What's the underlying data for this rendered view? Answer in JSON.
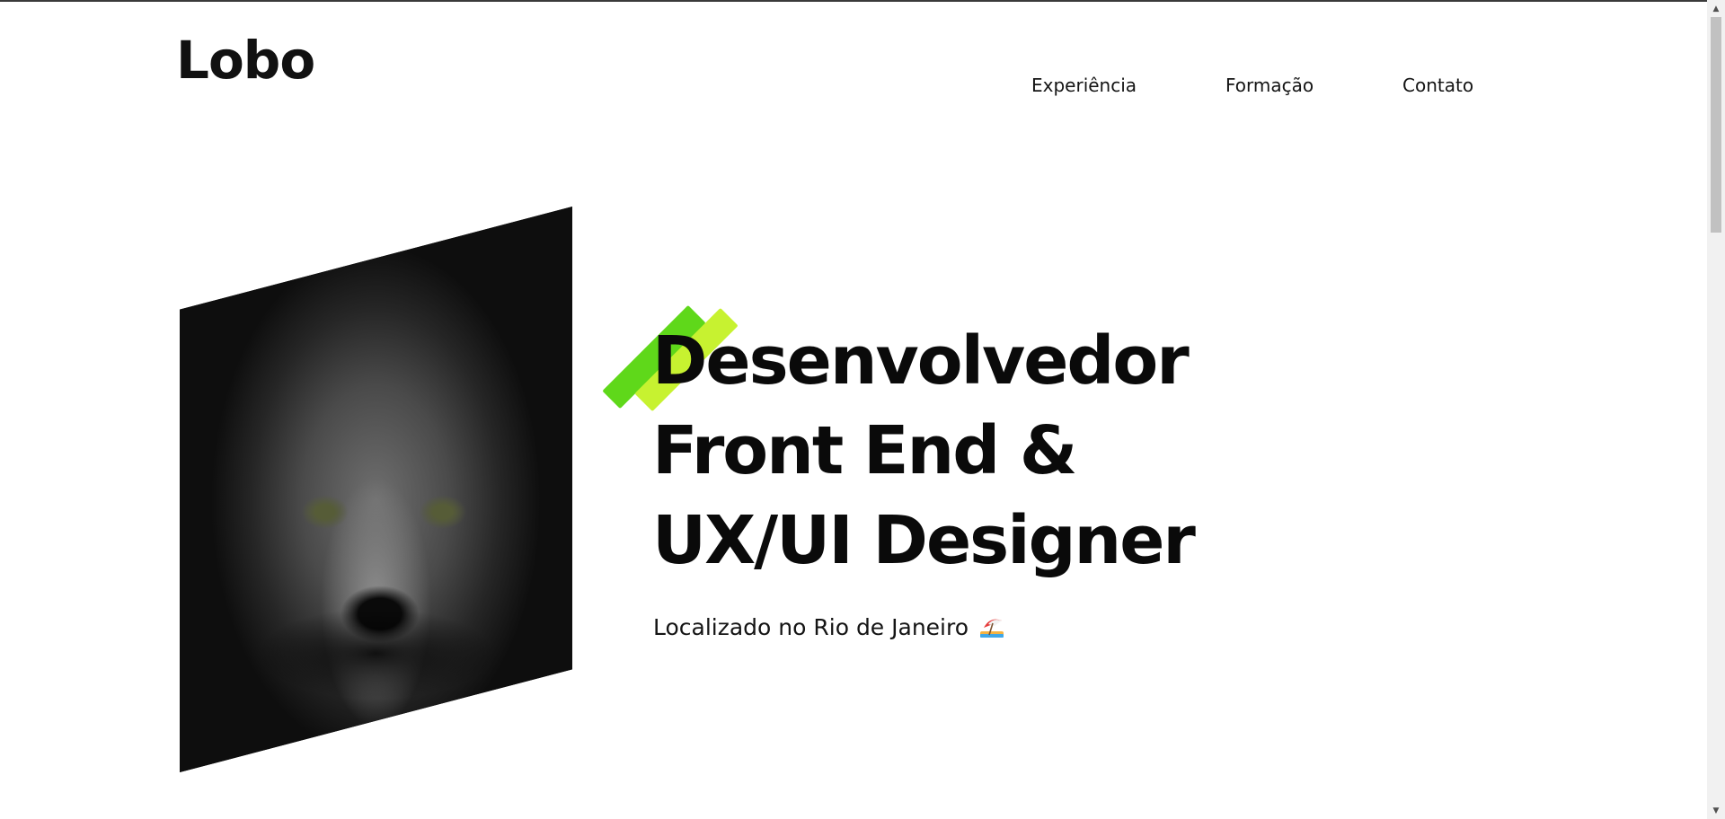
{
  "header": {
    "logo": "Lobo",
    "nav": [
      {
        "label": "Experiência"
      },
      {
        "label": "Formação"
      },
      {
        "label": "Contato"
      }
    ]
  },
  "hero": {
    "headline_lines": [
      "Desenvolvedor",
      "Front End &",
      "UX/UI Designer"
    ],
    "location": "Localizado no Rio de Janeiro",
    "location_icon": "beach-umbrella-icon",
    "accent_colors": [
      "#5fd81a",
      "#c7f230"
    ]
  },
  "scrollbar": {
    "up_arrow": "▲",
    "down_arrow": "▼"
  }
}
